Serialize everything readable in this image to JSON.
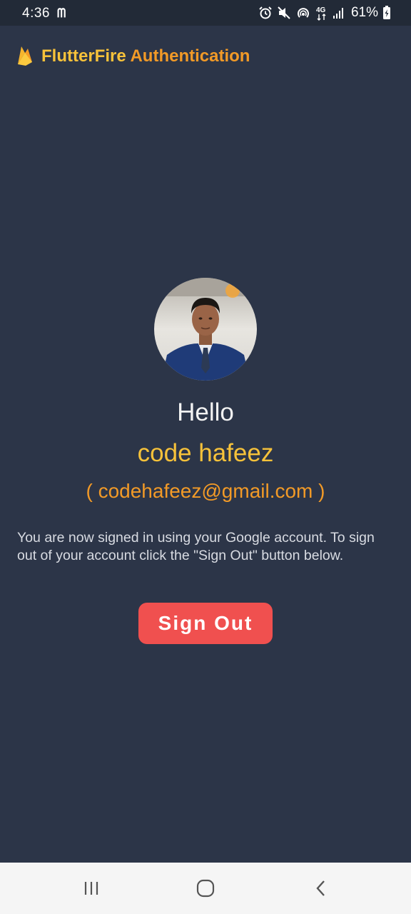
{
  "status_bar": {
    "time": "4:36",
    "app_icon": "ᗰ",
    "battery_percent": "61%",
    "icons": [
      "alarm-icon",
      "mute-icon",
      "hotspot-icon",
      "4g-icon",
      "signal-icon",
      "battery-icon"
    ]
  },
  "app_bar": {
    "title_part1": "FlutterFire",
    "title_part2": "Authentication",
    "logo_icon": "firebase-flame-icon"
  },
  "profile": {
    "greeting": "Hello",
    "name": "code hafeez",
    "email": "( codehafeez@gmail.com )",
    "info": "You are now signed in using your Google account. To sign out of your account click the \"Sign Out\" button below."
  },
  "actions": {
    "sign_out_label": "Sign Out"
  },
  "nav_bar": {
    "buttons": [
      "recents-icon",
      "home-icon",
      "back-icon"
    ]
  },
  "colors": {
    "background": "#2c3548",
    "status_bar": "#222a37",
    "title_yellow": "#f7c23a",
    "title_orange": "#f29a27",
    "button_red": "#f0504f",
    "nav_bar": "#f5f5f5"
  }
}
